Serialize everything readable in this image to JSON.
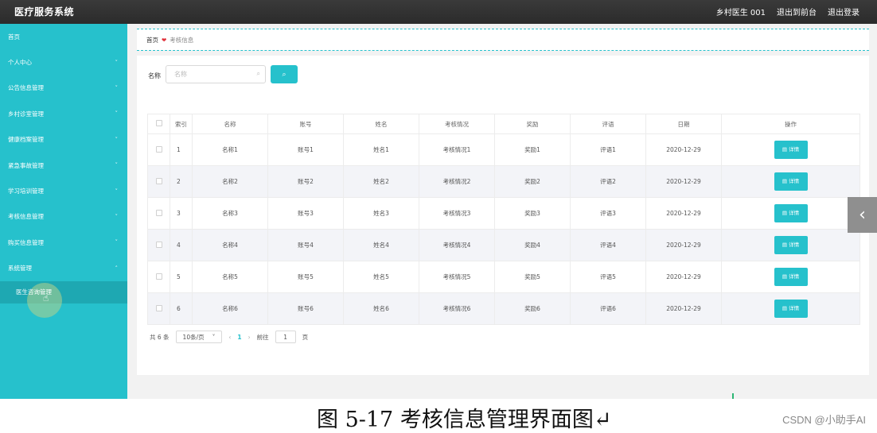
{
  "app": {
    "title": "医疗服务系统",
    "user": "乡村医生 001",
    "link_frontend": "退出到前台",
    "link_logout": "退出登录"
  },
  "sidebar": {
    "items": [
      {
        "label": "首页",
        "chevron": ""
      },
      {
        "label": "个人中心",
        "chevron": "˅"
      },
      {
        "label": "公告信息管理",
        "chevron": "˅"
      },
      {
        "label": "乡村诊室管理",
        "chevron": "˅"
      },
      {
        "label": "健康档案管理",
        "chevron": "˅"
      },
      {
        "label": "紧急事故管理",
        "chevron": "˅"
      },
      {
        "label": "学习培训管理",
        "chevron": "˅"
      },
      {
        "label": "考核信息管理",
        "chevron": "˅"
      },
      {
        "label": "购买信息管理",
        "chevron": "˅"
      },
      {
        "label": "系统管理",
        "chevron": "˄"
      }
    ],
    "subitem": "医生咨询管理"
  },
  "breadcrumb": {
    "home": "首页",
    "sep": "❤",
    "current": "考核信息"
  },
  "search": {
    "label": "名称",
    "placeholder": "名称",
    "icon": "search-icon"
  },
  "table": {
    "headers": [
      "索引",
      "名称",
      "账号",
      "姓名",
      "考核情况",
      "奖励",
      "评语",
      "日期",
      "操作"
    ],
    "rows": [
      {
        "idx": "1",
        "name": "名称1",
        "account": "账号1",
        "person": "姓名1",
        "status": "考核情况1",
        "reward": "奖励1",
        "comment": "评语1",
        "date": "2020-12-29",
        "action": "详情"
      },
      {
        "idx": "2",
        "name": "名称2",
        "account": "账号2",
        "person": "姓名2",
        "status": "考核情况2",
        "reward": "奖励2",
        "comment": "评语2",
        "date": "2020-12-29",
        "action": "详情"
      },
      {
        "idx": "3",
        "name": "名称3",
        "account": "账号3",
        "person": "姓名3",
        "status": "考核情况3",
        "reward": "奖励3",
        "comment": "评语3",
        "date": "2020-12-29",
        "action": "详情"
      },
      {
        "idx": "4",
        "name": "名称4",
        "account": "账号4",
        "person": "姓名4",
        "status": "考核情况4",
        "reward": "奖励4",
        "comment": "评语4",
        "date": "2020-12-29",
        "action": "详情"
      },
      {
        "idx": "5",
        "name": "名称5",
        "account": "账号5",
        "person": "姓名5",
        "status": "考核情况5",
        "reward": "奖励5",
        "comment": "评语5",
        "date": "2020-12-29",
        "action": "详情"
      },
      {
        "idx": "6",
        "name": "名称6",
        "account": "账号6",
        "person": "姓名6",
        "status": "考核情况6",
        "reward": "奖励6",
        "comment": "评语6",
        "date": "2020-12-29",
        "action": "详情"
      }
    ]
  },
  "pager": {
    "total": "共 6 条",
    "page_size": "10条/页",
    "current": "1",
    "goto_label": "前往",
    "goto_value": "1",
    "page_suffix": "页"
  },
  "caption": {
    "text": "图 5-17 考核信息管理界面图↵",
    "credit": "CSDN @小助手AI"
  },
  "colors": {
    "accent": "#26c1cc",
    "topbar": "#2b2b2b"
  }
}
